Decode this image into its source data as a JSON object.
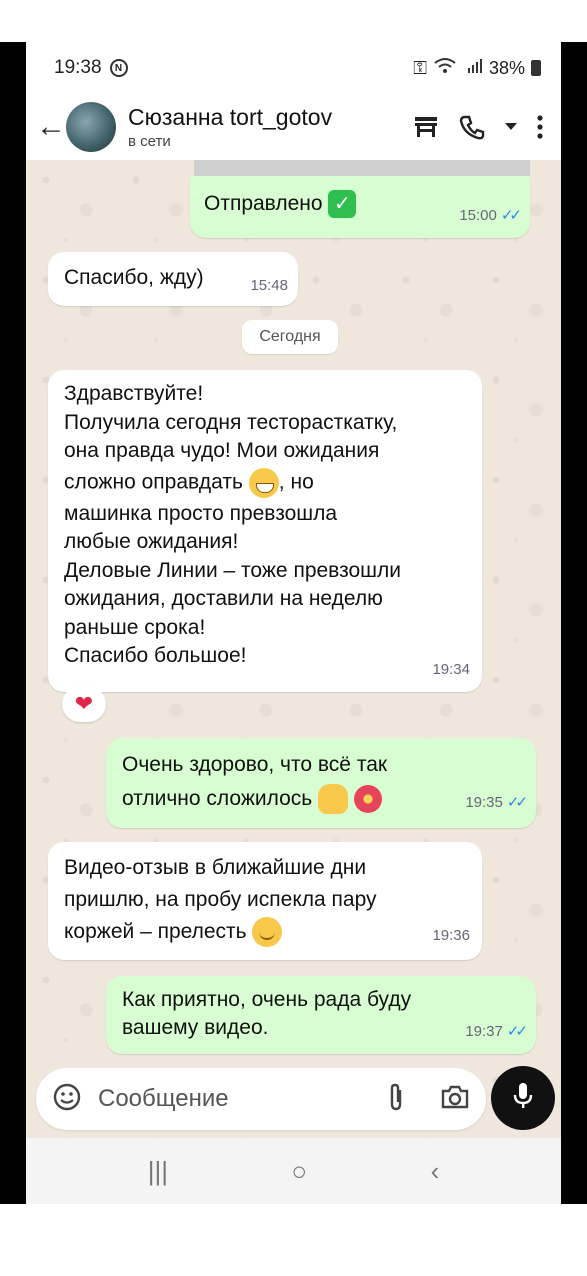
{
  "status_bar": {
    "time": "19:38",
    "notification_icon": "N",
    "battery": "38%",
    "icons": [
      "key-icon",
      "wifi-call-icon",
      "signal-icon",
      "battery-icon"
    ]
  },
  "header": {
    "contact_name": "Сюзанна tort_gotov",
    "contact_status": "в сети",
    "icons": [
      "back-arrow-icon",
      "avatar",
      "store-icon",
      "phone-icon",
      "chevron-down-icon",
      "more-vert-icon"
    ]
  },
  "messages": [
    {
      "direction": "out",
      "text": "Отправлено",
      "emoji": "check-mark-button",
      "time": "15:00",
      "read": true
    },
    {
      "direction": "in",
      "text": "Спасибо, жду)",
      "time": "15:48"
    },
    {
      "direction": "in",
      "lines": [
        "Здравствуйте!",
        "Получила сегодня тесторасткатку,",
        "она правда чудо! Мои ожидания",
        "сложно оправдать",
        ", но",
        "машинка просто превзошла",
        "любые ожидания!",
        "Деловые Линии – тоже превзошли",
        "ожидания, доставили на неделю",
        "раньше срока!",
        "Спасибо большое!"
      ],
      "time": "19:34",
      "reaction": "❤"
    },
    {
      "direction": "out",
      "lines": [
        "Очень здорово,  что всё  так",
        "отлично сложилось"
      ],
      "time": "19:35",
      "read": true
    },
    {
      "direction": "in",
      "lines": [
        "Видео-отзыв в ближайшие дни",
        "пришлю, на пробу испекла пару",
        "коржей – прелесть"
      ],
      "time": "19:36"
    },
    {
      "direction": "out",
      "lines": [
        "Как приятно, очень  рада буду",
        "вашему видео."
      ],
      "time": "19:37",
      "read": true
    }
  ],
  "date_separator": "Сегодня",
  "input": {
    "placeholder": "Сообщение",
    "icons": [
      "sticker-icon",
      "attach-icon",
      "camera-icon",
      "mic-icon"
    ]
  },
  "nav_bar": {
    "icons": [
      "recents-icon",
      "home-icon",
      "back-icon"
    ],
    "recents": "|||",
    "home": "○",
    "back": "‹"
  },
  "colors": {
    "incoming_bubble": "#ffffff",
    "outgoing_bubble": "#d9fdd3",
    "read_ticks": "#2b8ae6",
    "chat_background": "#efe7dc"
  }
}
